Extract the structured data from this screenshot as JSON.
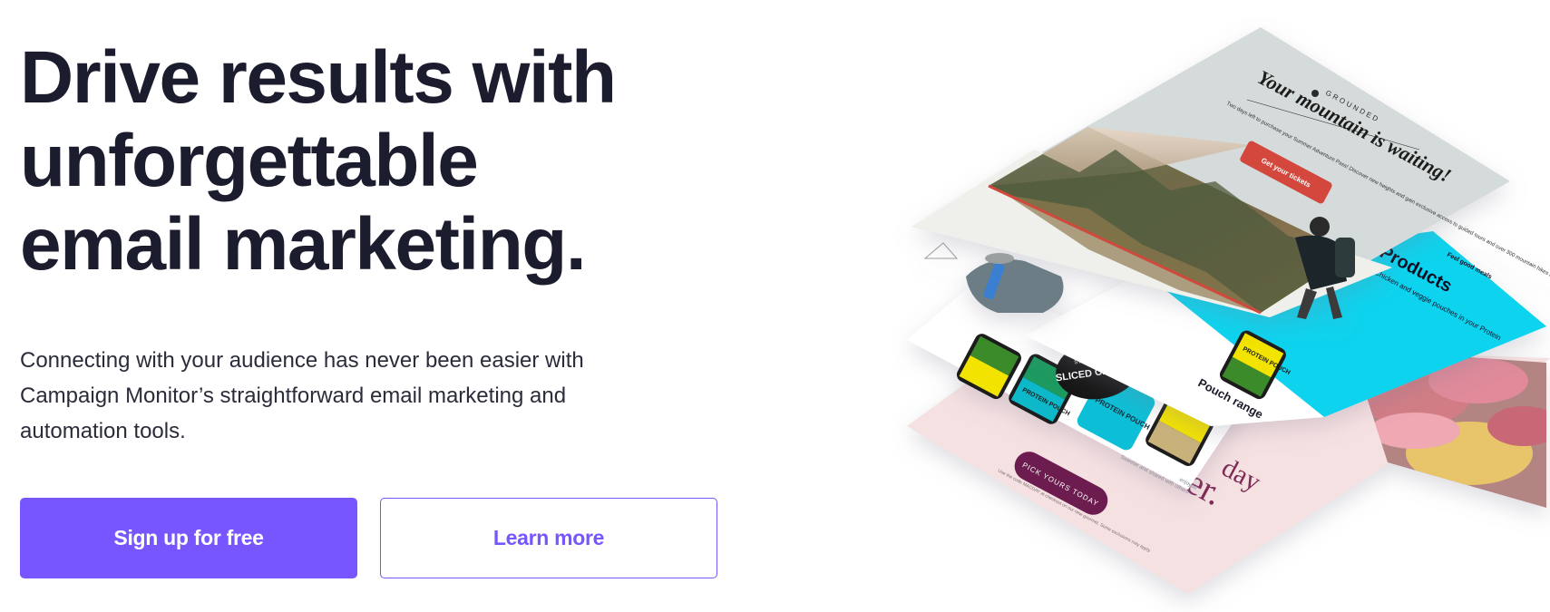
{
  "hero": {
    "headline": [
      "Drive results with",
      "unforgettable",
      "email marketing."
    ],
    "subtext": [
      "Connecting with your audience has never been easier with",
      "Campaign Monitor’s straightforward email marketing and",
      "automation tools."
    ]
  },
  "buttons": {
    "primary_label": "Sign up for free",
    "secondary_label": "Learn more"
  },
  "illustration": {
    "brand": "GROUNDED",
    "heading": "Your mountain is waiting!",
    "body_text": "Two days left to purchase your Summer Adventure Pass! Discover new heights and gain exclusive access to guided tours and over 300 mountain hikes and trails.",
    "cta": "Get your tickets",
    "products_heading": "Products",
    "products_tag": "Feel good meals",
    "products_text": "Chicken and veggie pouches in your Protein",
    "sliced_chicken_top": "STEAM COOKED",
    "sliced_chicken": "SLICED CHICKEN",
    "protein_pouch": "PROTEIN POUCH",
    "pouch_range": "Pouch range",
    "pink_cta": "PICK YOURS TODAY",
    "pink_heading_1": "day",
    "pink_heading_2": "er.",
    "fine_print": "Use the code MACDAY at checkout on our new gourmet. Some exclusions may apply.",
    "mid_text": "Sweeter and shared with others",
    "mid_text_2": "enjoyed"
  },
  "colors": {
    "accent": "#7856ff",
    "headline": "#1b1c2e",
    "cyan_card": "#07d3ee",
    "red_cta": "#d4473c",
    "plum_cta": "#6c1e4f",
    "pink_card": "#f6e1e2",
    "yellow_pouch": "#f2e300",
    "green_pouch": "#3a8b2a"
  }
}
